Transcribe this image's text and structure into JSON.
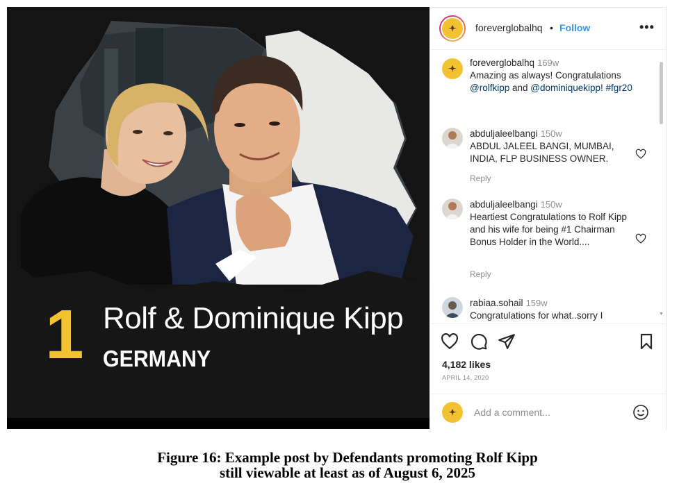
{
  "photo": {
    "rank": "1",
    "honoree_name": "Rolf & Dominique Kipp",
    "country": "GERMANY",
    "colors": {
      "background": "#141414",
      "rank": "#f2c230",
      "text": "#ffffff"
    }
  },
  "post": {
    "header": {
      "username": "foreverglobalhq",
      "separator": "•",
      "follow_label": "Follow",
      "more_label": "•••",
      "avatar_icon": "forever-logo-icon"
    },
    "comments": [
      {
        "username": "foreverglobalhq",
        "time": "169w",
        "text_before": "Amazing as always! Congratulations ",
        "mention1": "@rolfkipp",
        "text_mid": " and ",
        "mention2": "@dominiquekipp!",
        "text_after": " ",
        "hashtag": "#fgr20"
      },
      {
        "username": "abduljaleelbangi",
        "time": "150w",
        "text": "ABDUL JALEEL BANGI, MUMBAI, INDIA, FLP BUSINESS OWNER.",
        "reply_label": "Reply"
      },
      {
        "username": "abduljaleelbangi",
        "time": "150w",
        "text": "Heartiest Congratulations to Rolf Kipp and his wife for being #1 Chairman Bonus Holder in the World....",
        "reply_label": "Reply"
      },
      {
        "username": "rabiaa.sohail",
        "time": "159w",
        "text": "Congratulations for what..sorry I"
      }
    ],
    "likes": "4,182 likes",
    "date": "APRIL 14, 2020",
    "add_comment_placeholder": "Add a comment...",
    "icons": {
      "like": "heart-icon",
      "comment": "comment-bubble-icon",
      "share": "share-plane-icon",
      "save": "bookmark-icon",
      "emoji": "emoji-smile-icon"
    },
    "colors": {
      "link": "#3897f0",
      "mention": "#00376b",
      "muted": "#8e8e8e",
      "brand": "#f2c230"
    }
  },
  "caption": {
    "line1": "Figure 16: Example post by Defendants promoting Rolf Kipp",
    "line2": "still viewable at least as of August 6, 2025"
  }
}
